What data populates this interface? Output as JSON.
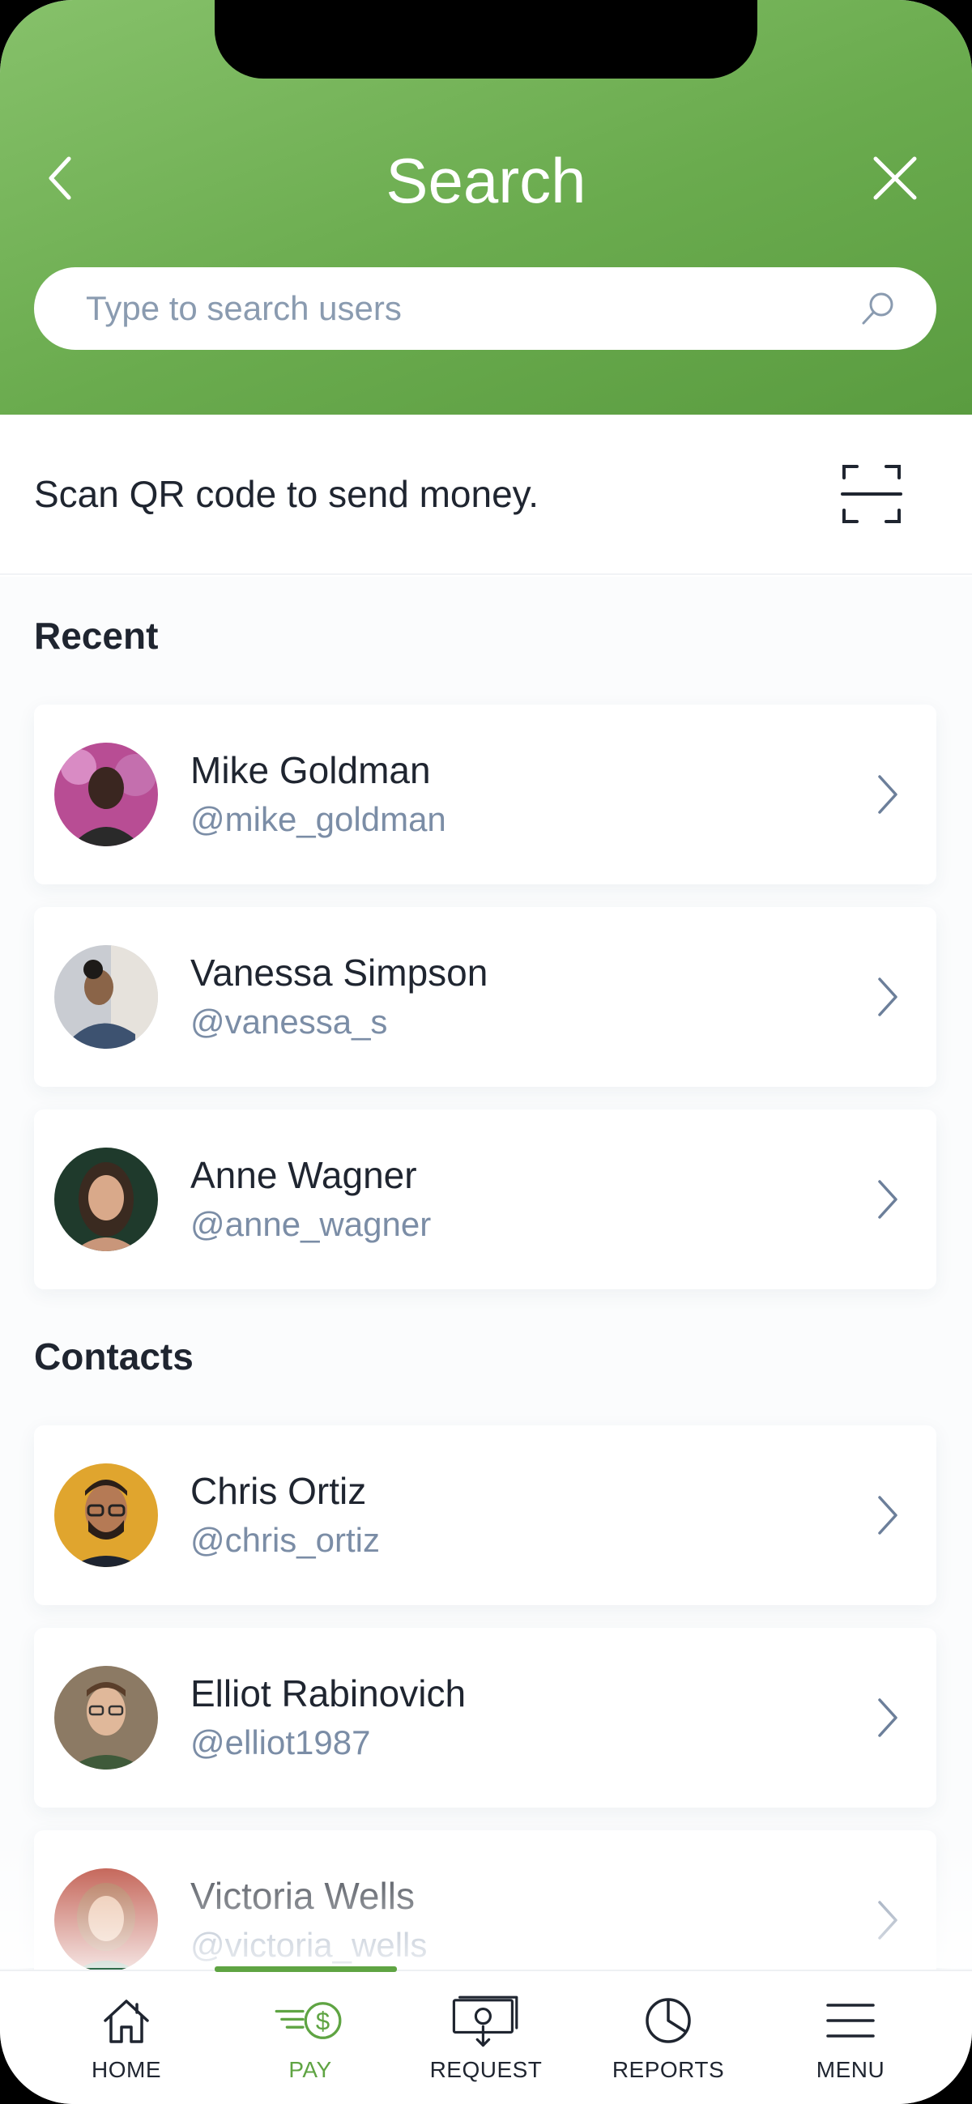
{
  "header": {
    "title": "Search",
    "back_icon": "chevron-left-icon",
    "close_icon": "close-icon"
  },
  "search": {
    "placeholder": "Type to search users",
    "value": ""
  },
  "qr": {
    "text": "Scan QR code to send money.",
    "icon": "qr-scan-icon"
  },
  "recent": {
    "title": "Recent",
    "items": [
      {
        "name": "Mike Goldman",
        "handle": "@mike_goldman",
        "avatar_color": "#7a3b6d"
      },
      {
        "name": "Vanessa Simpson",
        "handle": "@vanessa_s",
        "avatar_color": "#4a5a70"
      },
      {
        "name": "Anne Wagner",
        "handle": "@anne_wagner",
        "avatar_color": "#2c4a3a"
      }
    ]
  },
  "contacts": {
    "title": "Contacts",
    "items": [
      {
        "name": "Chris Ortiz",
        "handle": "@chris_ortiz",
        "avatar_color": "#d49a2a"
      },
      {
        "name": "Elliot Rabinovich",
        "handle": "@elliot1987",
        "avatar_color": "#6b5a45"
      },
      {
        "name": "Victoria Wells",
        "handle": "@victoria_wells",
        "avatar_color": "#a8402a"
      }
    ]
  },
  "nav": {
    "items": [
      {
        "label": "HOME",
        "icon": "home-icon"
      },
      {
        "label": "PAY",
        "icon": "pay-icon",
        "active": true
      },
      {
        "label": "REQUEST",
        "icon": "request-icon"
      },
      {
        "label": "REPORTS",
        "icon": "reports-icon"
      },
      {
        "label": "MENU",
        "icon": "menu-icon"
      }
    ]
  },
  "colors": {
    "brand_green": "#6aab4e",
    "active_green": "#5fa443",
    "handle_gray": "#7b8da6"
  }
}
